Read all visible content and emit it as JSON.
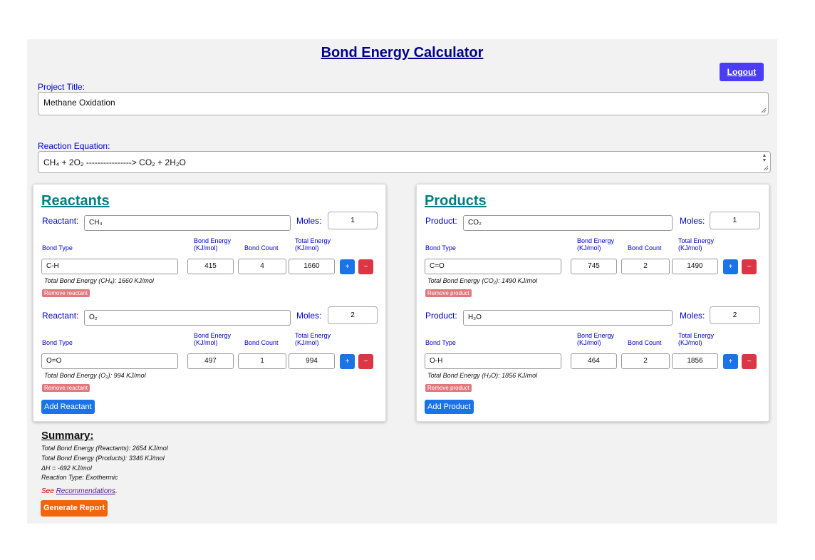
{
  "app": {
    "title": "Bond Energy Calculator",
    "logout_label": "Logout"
  },
  "project": {
    "label": "Project Title:",
    "value": "Methane Oxidation"
  },
  "equation": {
    "label": "Reaction Equation:",
    "value": "CH₄ + 2O₂ ----------------> CO₂ + 2H₂O"
  },
  "headers": {
    "bond_type": "Bond Type",
    "bond_energy_1": "Bond Energy",
    "bond_energy_2": "(KJ/mol)",
    "bond_count": "Bond Count",
    "total_energy_1": "Total Energy",
    "total_energy_2": "(KJ/mol)",
    "moles": "Moles:"
  },
  "reactants": {
    "title": "Reactants",
    "row_label": "Reactant:",
    "remove_label": "Remove reactant",
    "add_label": "Add Reactant",
    "items": [
      {
        "name": "CH₄",
        "moles": "1",
        "bond": "C-H",
        "energy": "415",
        "count": "4",
        "total": "1660",
        "summary": "Total Bond Energy (CH₄): 1660 KJ/mol"
      },
      {
        "name": "O₂",
        "moles": "2",
        "bond": "O=O",
        "energy": "497",
        "count": "1",
        "total": "994",
        "summary": "Total Bond Energy (O₂): 994 KJ/mol"
      }
    ]
  },
  "products": {
    "title": "Products",
    "row_label": "Product:",
    "remove_label": "Remove product",
    "add_label": "Add Product",
    "items": [
      {
        "name": "CO₂",
        "moles": "1",
        "bond": "C=O",
        "energy": "745",
        "count": "2",
        "total": "1490",
        "summary": "Total Bond Energy (CO₂): 1490 KJ/mol"
      },
      {
        "name": "H₂O",
        "moles": "2",
        "bond": "O-H",
        "energy": "464",
        "count": "2",
        "total": "1856",
        "summary": "Total Bond Energy (H₂O): 1856 KJ/mol"
      }
    ]
  },
  "buttons": {
    "plus": "+",
    "minus": "−"
  },
  "summary": {
    "title": "Summary:",
    "reactants": "Total Bond Energy (Reactants): 2654 KJ/mol",
    "products": "Total Bond Energy (Products): 3346 KJ/mol",
    "delta": "ΔH = -692 KJ/mol",
    "type": "Reaction Type: Exothermic",
    "see": "See",
    "link": "Recommendations",
    "period": ".",
    "generate": "Generate Report"
  },
  "colors": {
    "accent": "#4a3df5",
    "primary": "#1a73e8",
    "danger": "#dc3545",
    "heading": "#008080",
    "generate": "#f4650a"
  }
}
